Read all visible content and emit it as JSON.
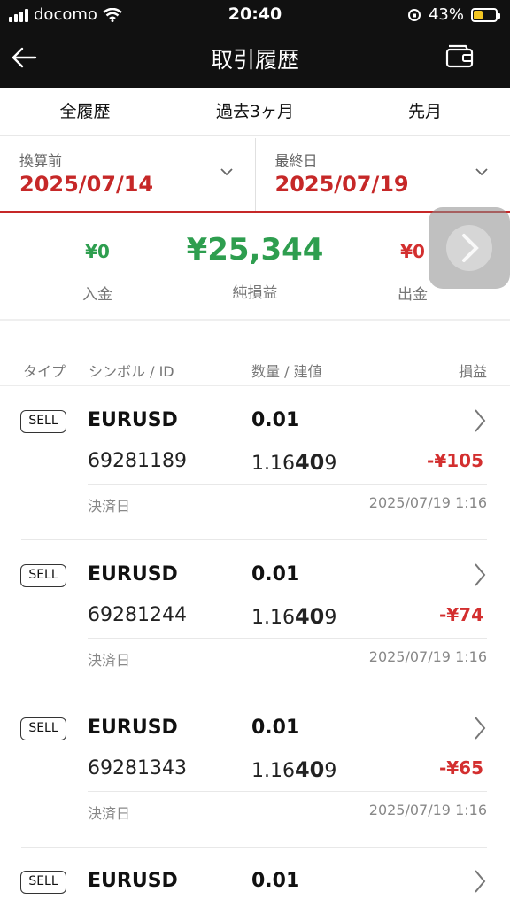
{
  "status": {
    "carrier": "docomo",
    "time": "20:40",
    "battery": "43%",
    "battery_level": 0.43
  },
  "nav": {
    "title": "取引履歴"
  },
  "tabs": [
    "全履歴",
    "過去3ヶ月",
    "先月"
  ],
  "date_filter": {
    "start_label": "換算前",
    "start_value": "2025/07/14",
    "end_label": "最終日",
    "end_value": "2025/07/19"
  },
  "summary": {
    "deposit_value": "¥0",
    "deposit_label": "入金",
    "net_value": "¥25,344",
    "net_label": "純損益",
    "withdraw_value": "¥0",
    "withdraw_label": "出金"
  },
  "table_header": {
    "type": "タイプ",
    "symbol": "シンボル / ID",
    "qty": "数量 / 建値",
    "pnl": "損益"
  },
  "trades": [
    {
      "type": "SELL",
      "symbol": "EURUSD",
      "qty": "0.01",
      "id": "69281189",
      "price_pre": "1.16",
      "price_big": "40",
      "price_post": "9",
      "pnl": "-¥105",
      "settle_label": "決済日",
      "settle_date": "2025/07/19 1:16"
    },
    {
      "type": "SELL",
      "symbol": "EURUSD",
      "qty": "0.01",
      "id": "69281244",
      "price_pre": "1.16",
      "price_big": "40",
      "price_post": "9",
      "pnl": "-¥74",
      "settle_label": "決済日",
      "settle_date": "2025/07/19 1:16"
    },
    {
      "type": "SELL",
      "symbol": "EURUSD",
      "qty": "0.01",
      "id": "69281343",
      "price_pre": "1.16",
      "price_big": "40",
      "price_post": "9",
      "pnl": "-¥65",
      "settle_label": "決済日",
      "settle_date": "2025/07/19 1:16"
    },
    {
      "type": "SELL",
      "symbol": "EURUSD",
      "qty": "0.01"
    }
  ],
  "colors": {
    "header_bg": "#111111",
    "accent_red": "#c62828",
    "profit_green": "#2e9e4f",
    "loss_red": "#d32f2f"
  }
}
